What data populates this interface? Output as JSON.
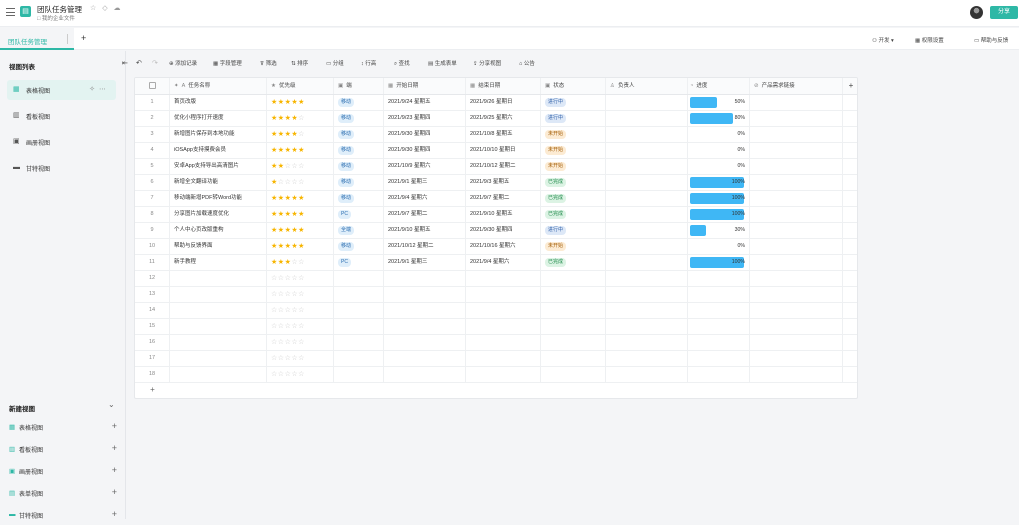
{
  "app": {
    "title": "团队任务管理",
    "workspace": "我的企业文件",
    "share_label": "分享",
    "title_icons": "☆ ◇ ☁"
  },
  "tabs": {
    "active_label": "团队任务管理",
    "add_label": "+"
  },
  "header_right": {
    "develop_label": "开发",
    "permissions_label": "权限设置",
    "help_label": "帮助与反馈"
  },
  "sidebar": {
    "title": "视图列表",
    "views": [
      {
        "label": "表格视图",
        "icon": "table-icon"
      },
      {
        "label": "看板视图",
        "icon": "kanban-icon"
      },
      {
        "label": "画册视图",
        "icon": "gallery-icon"
      },
      {
        "label": "甘特视图",
        "icon": "gantt-icon"
      }
    ],
    "new_view_title": "新建视图",
    "new_views": [
      {
        "label": "表格视图",
        "icon": "table-icon"
      },
      {
        "label": "看板视图",
        "icon": "kanban-icon"
      },
      {
        "label": "画册视图",
        "icon": "gallery-icon"
      },
      {
        "label": "表单视图",
        "icon": "form-icon"
      },
      {
        "label": "甘特视图",
        "icon": "gantt-icon"
      }
    ]
  },
  "toolbar": {
    "add_record": "添加记录",
    "field_manage": "字段管理",
    "filter": "筛选",
    "sort": "排序",
    "group": "分组",
    "row_height": "行高",
    "search": "查找",
    "generate_form": "生成表单",
    "share_view": "分享视图",
    "announcement": "公告"
  },
  "table": {
    "columns": [
      "任务名称",
      "优先级",
      "端",
      "开始日期",
      "结束日期",
      "状态",
      "负责人",
      "进度",
      "产品需求链接"
    ],
    "rows": [
      {
        "n": "1",
        "name": "首页改版",
        "stars": 5,
        "platform": "移动",
        "start": "2021/9/24 星期五",
        "end": "2021/9/26 星期日",
        "status": "进行中",
        "progress": 0.5,
        "pct": "50%"
      },
      {
        "n": "2",
        "name": "优化小程序打开速度",
        "stars": 4,
        "platform": "移动",
        "start": "2021/9/23 星期四",
        "end": "2021/9/25 星期六",
        "status": "进行中",
        "progress": 0.8,
        "pct": "80%"
      },
      {
        "n": "3",
        "name": "新增图片保存到本地功能",
        "stars": 4,
        "platform": "移动",
        "start": "2021/9/30 星期四",
        "end": "2021/10/8 星期五",
        "status": "未开始",
        "progress": 0,
        "pct": "0%"
      },
      {
        "n": "4",
        "name": "iOSApp支持摸费会员",
        "stars": 5,
        "platform": "移动",
        "start": "2021/9/30 星期四",
        "end": "2021/10/10 星期日",
        "status": "未开始",
        "progress": 0,
        "pct": "0%"
      },
      {
        "n": "5",
        "name": "安卓App支持导出高清图片",
        "stars": 2,
        "platform": "移动",
        "start": "2021/10/9 星期六",
        "end": "2021/10/12 星期二",
        "status": "未开始",
        "progress": 0,
        "pct": "0%"
      },
      {
        "n": "6",
        "name": "新增全文翻译功能",
        "stars": 1,
        "platform": "移动",
        "start": "2021/9/1 星期三",
        "end": "2021/9/3 星期五",
        "status": "已完成",
        "progress": 1,
        "pct": "100%"
      },
      {
        "n": "7",
        "name": "移动端新增PDF转Word功能",
        "stars": 5,
        "platform": "移动",
        "start": "2021/9/4 星期六",
        "end": "2021/9/7 星期二",
        "status": "已完成",
        "progress": 1,
        "pct": "100%"
      },
      {
        "n": "8",
        "name": "分享图片加载速度优化",
        "stars": 5,
        "platform": "PC",
        "start": "2021/9/7 星期二",
        "end": "2021/9/10 星期五",
        "status": "已完成",
        "progress": 1,
        "pct": "100%"
      },
      {
        "n": "9",
        "name": "个人中心页改版重构",
        "stars": 5,
        "platform": "全端",
        "start": "2021/9/10 星期五",
        "end": "2021/9/30 星期四",
        "status": "进行中",
        "progress": 0.3,
        "pct": "30%"
      },
      {
        "n": "10",
        "name": "帮助与反馈界面",
        "stars": 5,
        "platform": "移动",
        "start": "2021/10/12 星期二",
        "end": "2021/10/16 星期六",
        "status": "未开始",
        "progress": 0,
        "pct": "0%"
      },
      {
        "n": "11",
        "name": "新手教程",
        "stars": 3,
        "platform": "PC",
        "start": "2021/9/1 星期三",
        "end": "2021/9/4 星期六",
        "status": "已完成",
        "progress": 1,
        "pct": "100%"
      }
    ],
    "empty_rows": [
      "12",
      "13",
      "14",
      "15",
      "16",
      "17",
      "18"
    ],
    "add_row_label": "+",
    "add_col_label": "+"
  },
  "colors": {
    "accent": "#2eb8a6",
    "star": "#f7b500",
    "progress": "#3fb7f5"
  }
}
